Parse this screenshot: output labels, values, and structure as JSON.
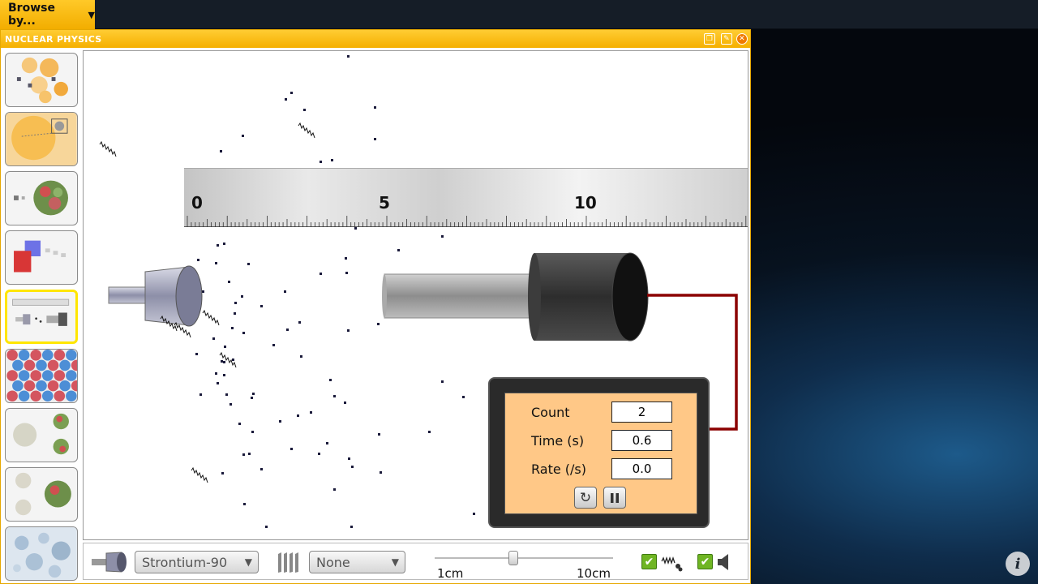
{
  "topbar": {
    "browse_label": "Browse by...",
    "info_label": "i"
  },
  "window": {
    "title": "NUCLEAR PHYSICS"
  },
  "ruler": {
    "labels": [
      "0",
      "5",
      "10"
    ]
  },
  "counter": {
    "rows": [
      {
        "label": "Count",
        "value": "2"
      },
      {
        "label": "Time (s)",
        "value": "0.6"
      },
      {
        "label": "Rate (/s)",
        "value": "0.0"
      }
    ]
  },
  "toolbar": {
    "source_select": "Strontium-90",
    "absorber_select": "None",
    "slider_min_label": "1cm",
    "slider_max_label": "10cm",
    "show_particles_checked": true,
    "sound_checked": true
  },
  "colors": {
    "accent": "#ffc928",
    "counter_panel": "#ffc887",
    "cable": "#8b0000"
  },
  "icons": [
    "caret-down-icon",
    "info-icon",
    "restore-icon",
    "edit-icon",
    "close-icon",
    "reset-icon",
    "pause-icon",
    "radiation-source-icon",
    "absorber-icon",
    "particle-icon",
    "speaker-icon",
    "check-icon"
  ]
}
